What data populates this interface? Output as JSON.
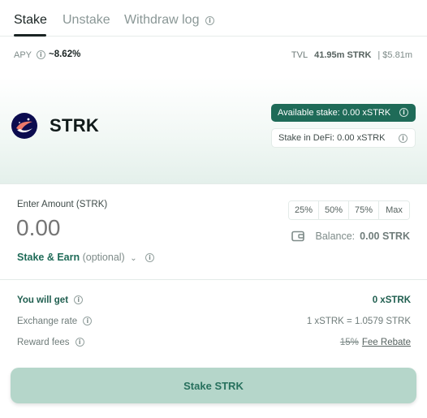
{
  "tabs": [
    {
      "label": "Stake",
      "active": true
    },
    {
      "label": "Unstake",
      "active": false
    },
    {
      "label": "Withdraw log",
      "active": false
    }
  ],
  "stats": {
    "apy_label": "APY",
    "apy_value": "~8.62%",
    "tvl_label": "TVL",
    "tvl_value": "41.95m STRK",
    "tvl_usd": "| $5.81m"
  },
  "token": {
    "name": "STRK",
    "logo_icon": "starknet-logo-icon",
    "available_stake": "Available stake: 0.00 xSTRK",
    "stake_in_defi": "Stake in DeFi: 0.00 xSTRK"
  },
  "amount": {
    "label": "Enter Amount (STRK)",
    "placeholder": "0.00",
    "value": "",
    "percent_buttons": [
      "25%",
      "50%",
      "75%",
      "Max"
    ],
    "balance_label": "Balance:",
    "balance_value": "0.00 STRK",
    "stake_earn_label": "Stake & Earn",
    "stake_earn_optional": "(optional)"
  },
  "summary": {
    "you_get_label": "You will get",
    "you_get_value": "0 xSTRK",
    "exchange_label": "Exchange rate",
    "exchange_value": "1 xSTRK = 1.0579 STRK",
    "reward_label": "Reward fees",
    "reward_fee_struck": "15%",
    "reward_rebate": "Fee Rebate"
  },
  "action": {
    "button_label": "Stake STRK"
  },
  "colors": {
    "accent": "#1f6b58",
    "button_bg": "#b5d6ca",
    "hero_gradient_end": "#e4f0eb"
  }
}
